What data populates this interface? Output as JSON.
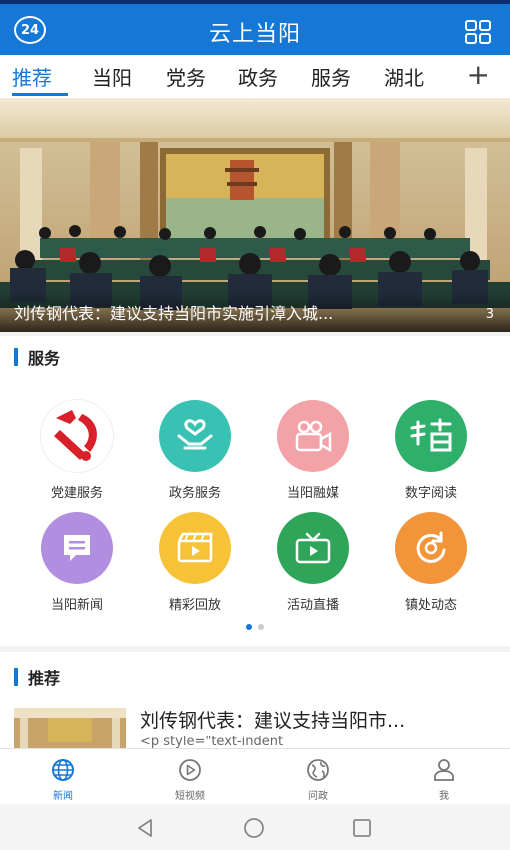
{
  "header": {
    "badge": "24",
    "title": "云上当阳",
    "menu_icon": "grid-icon"
  },
  "tabs": [
    {
      "label": "推荐",
      "active": true
    },
    {
      "label": "当阳",
      "active": false
    },
    {
      "label": "党务",
      "active": false
    },
    {
      "label": "政务",
      "active": false
    },
    {
      "label": "服务",
      "active": false
    },
    {
      "label": "湖北",
      "active": false
    }
  ],
  "tab_add_label": "+",
  "banner": {
    "caption": "刘传钢代表：建议支持当阳市实施引漳入城...",
    "index": "3"
  },
  "services": {
    "title": "服务",
    "items": [
      {
        "label": "党建服务",
        "icon": "party-emblem-icon",
        "color": "#ffffff"
      },
      {
        "label": "政务服务",
        "icon": "hands-heart-icon",
        "color": "#39c2b4"
      },
      {
        "label": "当阳融媒",
        "icon": "video-camera-icon",
        "color": "#f3a3a8"
      },
      {
        "label": "数字阅读",
        "icon": "calligraphy-read-icon",
        "color": "#2fb06a"
      },
      {
        "label": "当阳新闻",
        "icon": "message-icon",
        "color": "#b18ee0"
      },
      {
        "label": "精彩回放",
        "icon": "clapperboard-icon",
        "color": "#f6c338"
      },
      {
        "label": "活动直播",
        "icon": "tv-play-icon",
        "color": "#2fa55a"
      },
      {
        "label": "镇处动态",
        "icon": "refresh-circle-icon",
        "color": "#f2953a"
      }
    ],
    "page_count": 2,
    "current_page": 1
  },
  "recommend": {
    "title": "推荐",
    "items": [
      {
        "title": "刘传钢代表：建议支持当阳市...",
        "snippet": "<p style=\"text-indent"
      }
    ]
  },
  "bottom_nav": [
    {
      "label": "新闻",
      "icon": "globe-icon",
      "active": true
    },
    {
      "label": "短视频",
      "icon": "play-circle-icon",
      "active": false
    },
    {
      "label": "问政",
      "icon": "earth-icon",
      "active": false
    },
    {
      "label": "我",
      "icon": "user-icon",
      "active": false
    }
  ],
  "colors": {
    "primary": "#1577d6",
    "header_top": "#0d2c6e"
  }
}
